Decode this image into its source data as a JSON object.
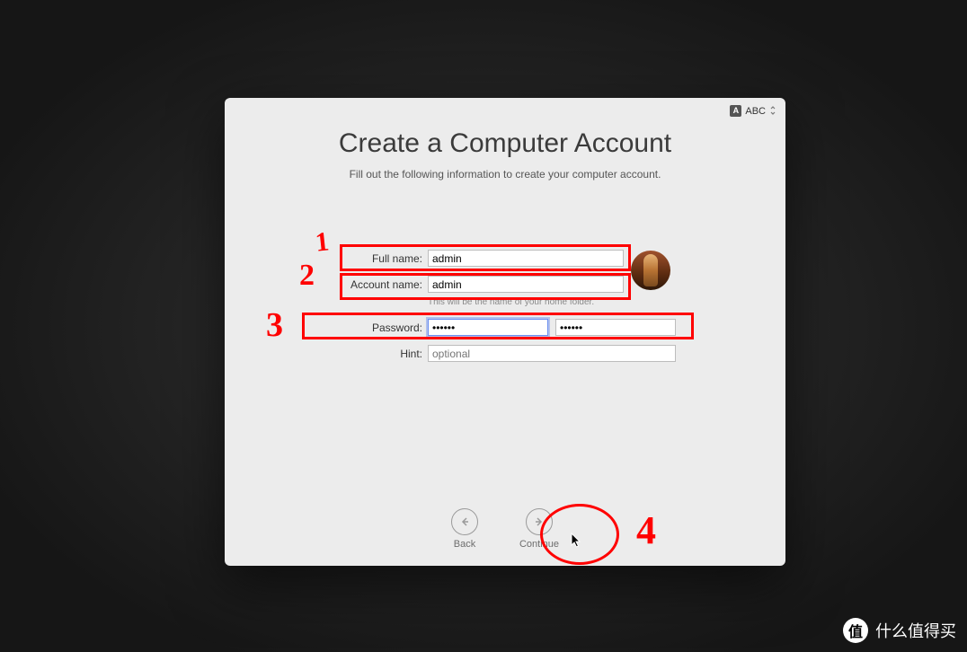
{
  "inputIndicator": {
    "iconLetter": "A",
    "label": "ABC"
  },
  "title": "Create a Computer Account",
  "subtitle": "Fill out the following information to create your computer account.",
  "form": {
    "fullName": {
      "label": "Full name:",
      "value": "admin"
    },
    "accountName": {
      "label": "Account name:",
      "value": "admin",
      "helper": "This will be the name of your home folder."
    },
    "password": {
      "label": "Password:",
      "value": "••••••",
      "verifyValue": "••••••"
    },
    "hint": {
      "label": "Hint:",
      "placeholder": "optional",
      "value": ""
    }
  },
  "nav": {
    "back": "Back",
    "continue": "Continue"
  },
  "annotations": {
    "n1": "1",
    "n2": "2",
    "n3": "3",
    "n4": "4"
  },
  "watermark": {
    "badge": "值",
    "text": "什么值得买"
  }
}
